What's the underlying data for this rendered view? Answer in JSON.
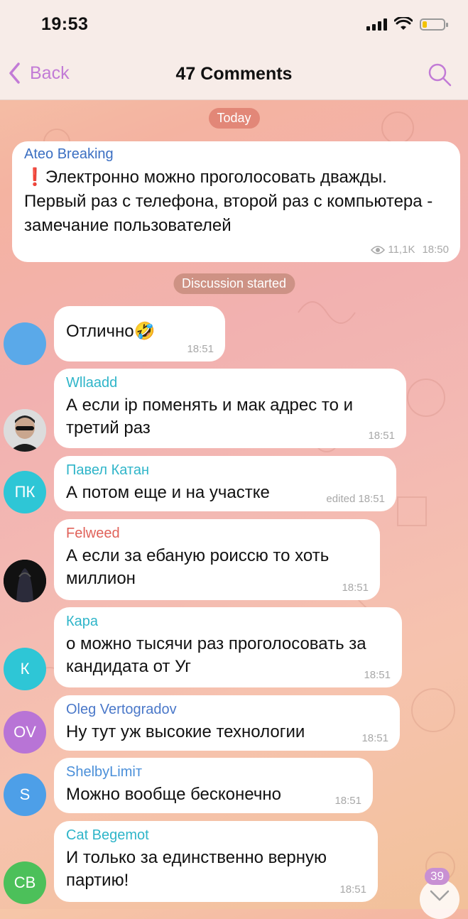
{
  "status_bar": {
    "time": "19:53"
  },
  "nav": {
    "back_label": "Back",
    "title": "47 Comments"
  },
  "pills": {
    "today": "Today",
    "discussion": "Discussion started"
  },
  "post": {
    "channel": "Ateo Breaking",
    "text": "Электронно можно проголосовать дважды. Первый раз с телефона, второй раз с компьютера - замечание пользователей",
    "views": "11,1K",
    "time": "18:50"
  },
  "messages": [
    {
      "sender": "",
      "text": "Отлично🤣",
      "meta": "18:51",
      "avatar": {
        "initials": "",
        "color": "#5aa9e9"
      }
    },
    {
      "sender": "Wllaadd",
      "sender_color": "#2fb5c9",
      "text": "А если ip поменять и мак адрес то и третий раз",
      "meta": "18:51",
      "avatar": {
        "initials": "",
        "color": "#d8d8d8"
      }
    },
    {
      "sender": "Павел Катан",
      "sender_color": "#2fb5c9",
      "text": "А потом еще и на участке",
      "meta": "edited 18:51",
      "avatar": {
        "initials": "ПК",
        "color": "#2ec6d6"
      }
    },
    {
      "sender": "Felweed",
      "sender_color": "#e0625a",
      "text": "А если за ебаную роиссю то хоть миллион",
      "meta": "18:51",
      "avatar": {
        "initials": "",
        "color": "#151515"
      }
    },
    {
      "sender": "Кара",
      "sender_color": "#2fb5c9",
      "text": "о можно тысячи раз проголосовать за кандидата от Уг",
      "meta": "18:51",
      "avatar": {
        "initials": "К",
        "color": "#2ec6d6"
      }
    },
    {
      "sender": "Oleg Vertogradov",
      "sender_color": "#4a78c9",
      "text": "Ну тут уж высокие технологии",
      "meta": "18:51",
      "avatar": {
        "initials": "OV",
        "color": "#b874d6"
      }
    },
    {
      "sender": "ShelbyLimiт",
      "sender_color": "#4a8fd9",
      "text": "Можно вообще бесконечно",
      "meta": "18:51",
      "avatar": {
        "initials": "S",
        "color": "#4d9fe8"
      }
    },
    {
      "sender": "Cat Begemot",
      "sender_color": "#2fb5c9",
      "text": "И только за единственно верную партию!",
      "meta": "18:51",
      "avatar": {
        "initials": "CB",
        "color": "#4cc05a"
      }
    }
  ],
  "scroll": {
    "unread_count": "39"
  },
  "colors": {
    "accent": "#c27bd6",
    "channel_name": "#3b6fc2"
  },
  "icons": [
    "back-chevron-icon",
    "search-icon",
    "signal-icon",
    "wifi-icon",
    "battery-icon",
    "eye-icon",
    "chevron-down-icon",
    "warning-exclamation-icon"
  ]
}
